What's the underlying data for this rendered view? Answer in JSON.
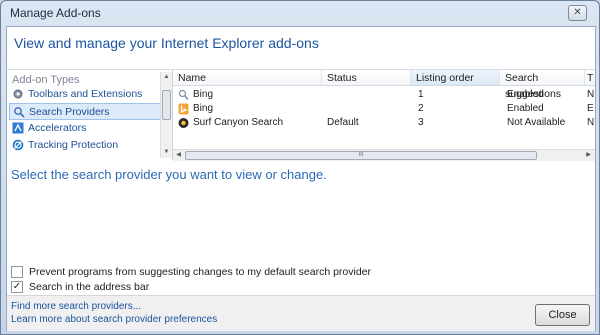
{
  "window": {
    "title": "Manage Add-ons",
    "close_glyph": "✕"
  },
  "header": {
    "text": "View and manage your Internet Explorer add-ons"
  },
  "left_pane": {
    "label": "Add-on Types",
    "items": [
      {
        "label": "Toolbars and Extensions",
        "icon": "gear-icon"
      },
      {
        "label": "Search Providers",
        "icon": "search-icon"
      },
      {
        "label": "Accelerators",
        "icon": "accelerator-icon"
      },
      {
        "label": "Tracking Protection",
        "icon": "tracking-protection-icon"
      }
    ]
  },
  "list": {
    "columns": [
      "Name",
      "Status",
      "Listing order",
      "Search suggestions",
      "T"
    ],
    "rows": [
      {
        "name": "Bing",
        "status": "",
        "order": "1",
        "suggestions": "Enabled",
        "extra": "N"
      },
      {
        "name": "Bing",
        "status": "",
        "order": "2",
        "suggestions": "Enabled",
        "extra": "E"
      },
      {
        "name": "Surf Canyon Search",
        "status": "Default",
        "order": "3",
        "suggestions": "Not Available",
        "extra": "N"
      }
    ],
    "hscroll_grip": "III"
  },
  "details": {
    "message": "Select the search provider you want to view or change."
  },
  "options": [
    {
      "label": "Prevent programs from suggesting changes to my default search provider",
      "checked": false,
      "mark": ""
    },
    {
      "label": "Search in the address bar",
      "checked": true,
      "mark": "✓"
    }
  ],
  "footer": {
    "links": [
      "Find more search providers...",
      "Learn more about search provider preferences"
    ],
    "close_label": "Close"
  },
  "colors": {
    "accent": "#1a55a0",
    "message": "#2d6ab4"
  }
}
